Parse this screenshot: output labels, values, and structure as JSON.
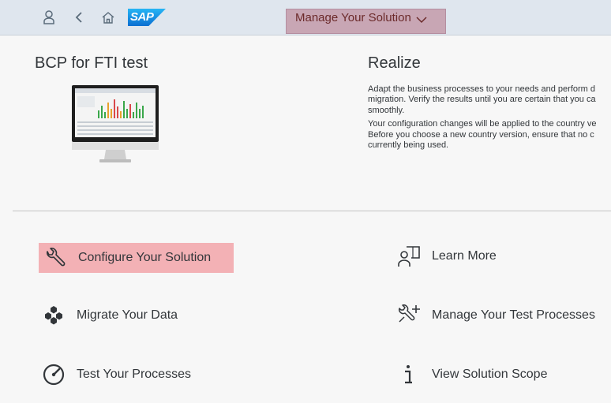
{
  "shell": {
    "title": "Manage Your Solution",
    "icons": [
      "user-icon",
      "back-icon",
      "home-icon"
    ],
    "logo_text": "SAP"
  },
  "tile": {
    "title": "BCP for FTI test"
  },
  "phase": {
    "title": "Realize",
    "paragraphs": [
      "Adapt the business processes to your needs and perform d migration. Verify the results until you are certain that you ca smoothly.",
      "Your configuration changes will be applied to the country ve Before you choose a new country version, ensure that no c currently being used."
    ]
  },
  "actions": {
    "configure": "Configure Your Solution",
    "migrate": "Migrate Your Data",
    "test": "Test Your Processes",
    "learn": "Learn More",
    "manage_tests": "Manage Your Test Processes",
    "scope": "View Solution Scope"
  },
  "colors": {
    "highlight": "#f3b1b5",
    "title_box": "#c8a6b4",
    "shell_bg": "#dfe6ee"
  }
}
